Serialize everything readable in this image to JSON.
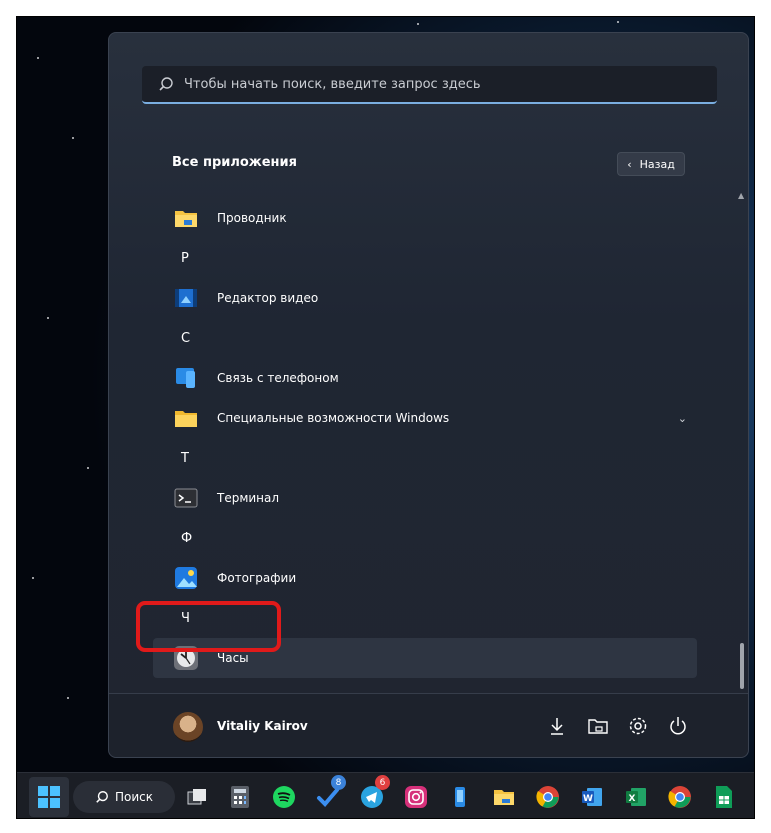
{
  "search": {
    "placeholder": "Чтобы начать поиск, введите запрос здесь"
  },
  "apps_header": {
    "title": "Все приложения",
    "back_label": "Назад"
  },
  "app_list": {
    "explorer": "Проводник",
    "letter_r": "Р",
    "video_editor": "Редактор видео",
    "letter_s": "С",
    "phone_link": "Связь с телефоном",
    "accessibility": "Специальные возможности Windows",
    "letter_t": "Т",
    "terminal": "Терминал",
    "letter_f": "Ф",
    "photos": "Фотографии",
    "letter_ch": "Ч",
    "clock": "Часы"
  },
  "footer": {
    "user_name": "Vitaliy Kairov"
  },
  "taskbar": {
    "search_label": "Поиск",
    "badges": {
      "tasks": "8",
      "telegram": "6"
    }
  },
  "colors": {
    "accent": "#7aaee0",
    "highlight_box": "#e01a1a"
  }
}
